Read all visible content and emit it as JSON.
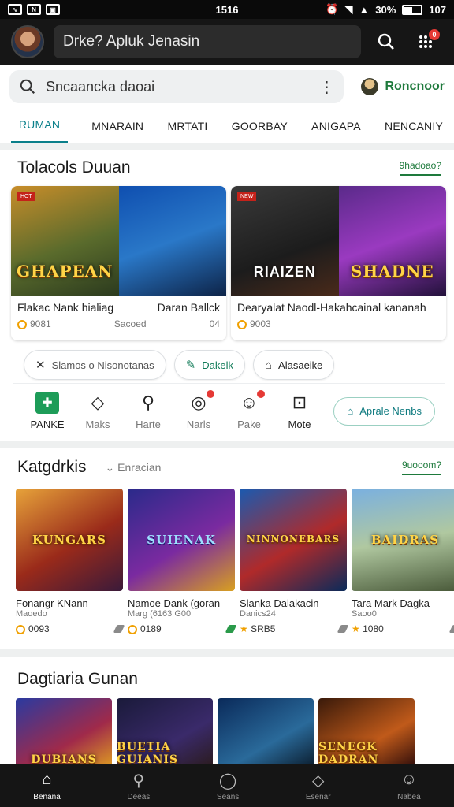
{
  "status_bar": {
    "time": "1516",
    "battery": "30%",
    "right_time": "107"
  },
  "header": {
    "title": "Drke? Apluk Jenasin"
  },
  "search": {
    "text": "Sncaancka daoai",
    "recommend_label": "Roncnoor"
  },
  "tabs": [
    "RUMAN",
    "MNARAIN",
    "MRTATI",
    "GOORBAY",
    "ANIGAPA",
    "NENCANIY"
  ],
  "featured": {
    "title": "Tolacols Duuan",
    "more": "9hadoao?",
    "cards": [
      {
        "logo_left": "GHAPEAN",
        "name": "Flakac Nank hialiag",
        "name2": "Daran Ballck",
        "price": "9081",
        "sub": "Sacoed",
        "sub2": "04"
      },
      {
        "logo_left": "RIAIZEN",
        "logo_right": "SHADNE",
        "name": "Dearyalat Naodl-Hakahcainal kananah",
        "price": "9003"
      }
    ]
  },
  "chips": [
    {
      "label": "Slamos o Nisonotanas",
      "icon": "close-icon"
    },
    {
      "label": "Dakelk",
      "icon": "pencil-icon"
    },
    {
      "label": "Alasaeike",
      "icon": "tag-icon"
    }
  ],
  "actions": [
    {
      "label": "PANKE",
      "icon": "game-icon"
    },
    {
      "label": "Maks",
      "icon": "tag-icon"
    },
    {
      "label": "Harte",
      "icon": "joystick-icon"
    },
    {
      "label": "Narls",
      "icon": "bell-icon"
    },
    {
      "label": "Pake",
      "icon": "gamepad-icon"
    },
    {
      "label": "Mote",
      "icon": "square-dot-icon"
    }
  ],
  "open_button": "Aprale Nenbs",
  "categories": {
    "title": "Katgdrkis",
    "filter": "Enracian",
    "more": "9uooom?",
    "cards": [
      {
        "logo": "KUNGARS",
        "name": "Fonangr KNann",
        "meta": "Maoedo",
        "score": "0093"
      },
      {
        "logo": "SUIENAK",
        "name": "Namoe Dank (goran",
        "meta": "Marg (6163",
        "meta2": "G00",
        "score": "0189"
      },
      {
        "logo": "NINNONEBARS",
        "name": "Slanka Dalakacin",
        "meta": "Danics24",
        "score": "SRB5"
      },
      {
        "logo": "BAIDRAS",
        "name": "Tara Mark Dagka",
        "meta": "Saoo0",
        "score": "1080"
      }
    ]
  },
  "section3": {
    "title": "Dagtiaria Gunan",
    "logos": [
      "DUBIANS",
      "BUETIA GUIANIS",
      "",
      "SENEGK DADRAN"
    ]
  },
  "bottom_nav": [
    "Benana",
    "Deeas",
    "Seans",
    "Esenar",
    "Nabea"
  ],
  "colors": {
    "accent": "#0a7f8a",
    "green": "#1e7a3c",
    "badge": "#e53935"
  }
}
